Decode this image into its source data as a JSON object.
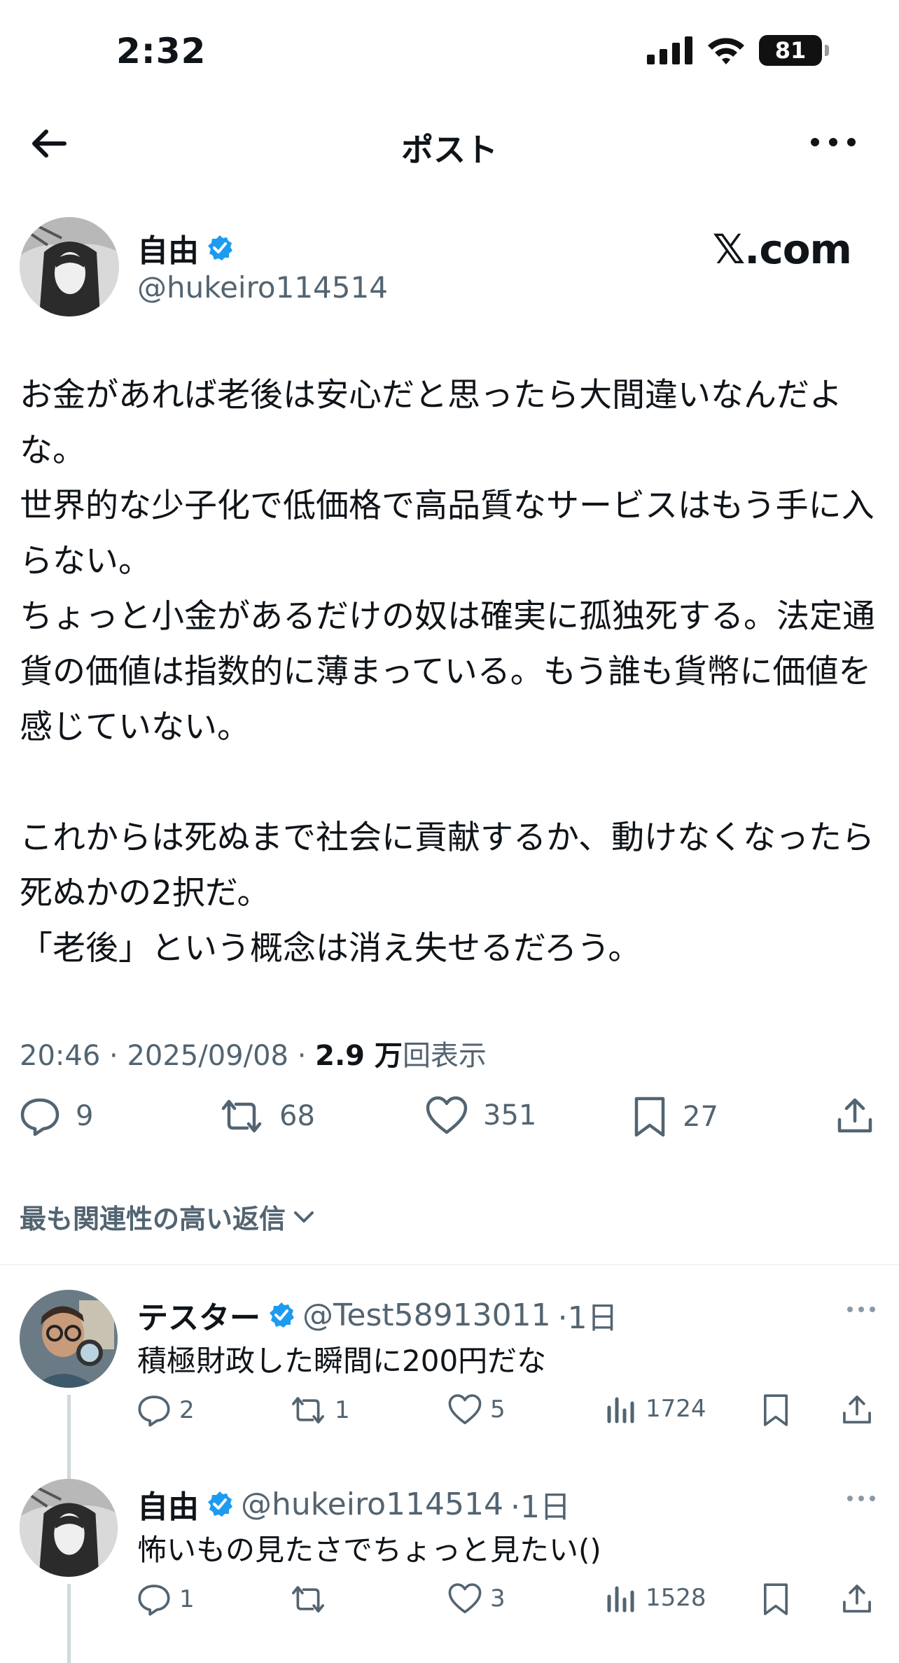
{
  "status": {
    "time": "2:32",
    "battery": "81"
  },
  "nav": {
    "title": "ポスト"
  },
  "post": {
    "author_name": "自由",
    "author_handle": "@hukeiro114514",
    "brand": "𝕏.com",
    "body": "お金があれば老後は安心だと思ったら大間違いなんだよな。\n世界的な少子化で低価格で高品質なサービスはもう手に入らない。\nちょっと小金があるだけの奴は確実に孤独死する。法定通貨の価値は指数的に薄まっている。もう誰も貨幣に価値を感じていない。\n\nこれからは死ぬまで社会に貢献するか、動けなくなったら死ぬかの2択だ。\n「老後」という概念は消え失せるだろう。",
    "time": "20:46",
    "date": "2025/09/08",
    "views_value": "2.9 万",
    "views_label": "回表示",
    "separator": "·",
    "replies": "9",
    "reposts": "68",
    "likes": "351",
    "bookmarks": "27"
  },
  "sort": {
    "label": "最も関連性の高い返信"
  },
  "replies": [
    {
      "name": "テスター",
      "handle": "@Test58913011",
      "age": "·1日",
      "text": "積極財政した瞬間に200円だな",
      "replies": "2",
      "reposts": "1",
      "likes": "5",
      "views": "1724"
    },
    {
      "name": "自由",
      "handle": "@hukeiro114514",
      "age": "·1日",
      "text": "怖いもの見たさでちょっと見たい()",
      "replies": "1",
      "reposts": "",
      "likes": "3",
      "views": "1528"
    }
  ],
  "colors": {
    "text": "#0f1419",
    "secondary": "#536471",
    "verified": "#1d9bf0",
    "line": "#cfd9de"
  }
}
